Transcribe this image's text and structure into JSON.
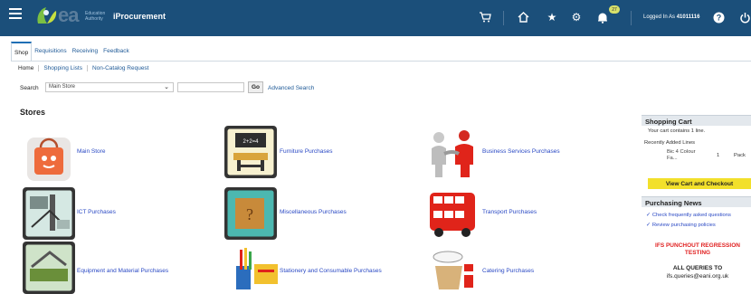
{
  "header": {
    "logo_mark": "ea",
    "org_name": "Education Authority",
    "app_title": "iProcurement",
    "notification_count": "27",
    "logged_in_label": "Logged In As",
    "user_id": "41011116",
    "icons": [
      "menu-icon",
      "cart-icon",
      "home-icon",
      "favorites-star-icon",
      "settings-gear-icon",
      "notifications-bell-icon",
      "help-icon",
      "power-icon"
    ],
    "background": "#1b4f7a"
  },
  "tabs": [
    "Shop",
    "Requisitions",
    "Receiving",
    "Feedback"
  ],
  "subtabs": [
    "Home",
    "Shopping Lists",
    "Non-Catalog Request"
  ],
  "search": {
    "label": "Search",
    "selected_store": "Main Store",
    "query": "",
    "go_label": "Go",
    "advanced_label": "Advanced Search"
  },
  "stores": {
    "title": "Stores",
    "items": [
      {
        "name": "Main Store",
        "icon": "shopping-bag-icon"
      },
      {
        "name": "Furniture Purchases",
        "icon": "classroom-desk-icon"
      },
      {
        "name": "Business Services Purchases",
        "icon": "handshake-icon"
      },
      {
        "name": "ICT Purchases",
        "icon": "network-computer-icon"
      },
      {
        "name": "Miscellaneous Purchases",
        "icon": "miscellaneous-box-icon"
      },
      {
        "name": "Transport Purchases",
        "icon": "bus-icon"
      },
      {
        "name": "Equipment and Material Purchases",
        "icon": "equipment-icon"
      },
      {
        "name": "Stationery and Consumable Purchases",
        "icon": "stationery-icon"
      },
      {
        "name": "Catering Purchases",
        "icon": "catering-icon"
      }
    ]
  },
  "shopping_cart": {
    "title": "Shopping Cart",
    "summary": "Your cart contains 1 line.",
    "recent_label": "Recently Added Lines",
    "line_item": {
      "name_l1": "Bic 4 Colour",
      "name_l2": "Fa...",
      "qty": "1",
      "uom": "Pack"
    },
    "button_label": "View Cart and Checkout",
    "button_color": "#f2e02b"
  },
  "purchasing_news": {
    "title": "Purchasing News",
    "items": [
      "Check frequently asked questions",
      "Review purchasing policies"
    ],
    "alert_l1": "IFS PUNCHOUT REGRESSION",
    "alert_l2": "TESTING",
    "alert_color": "#e02020",
    "queries_l1": "ALL QUERIES TO",
    "queries_l2": "ifs.queries@eani.org.uk"
  }
}
